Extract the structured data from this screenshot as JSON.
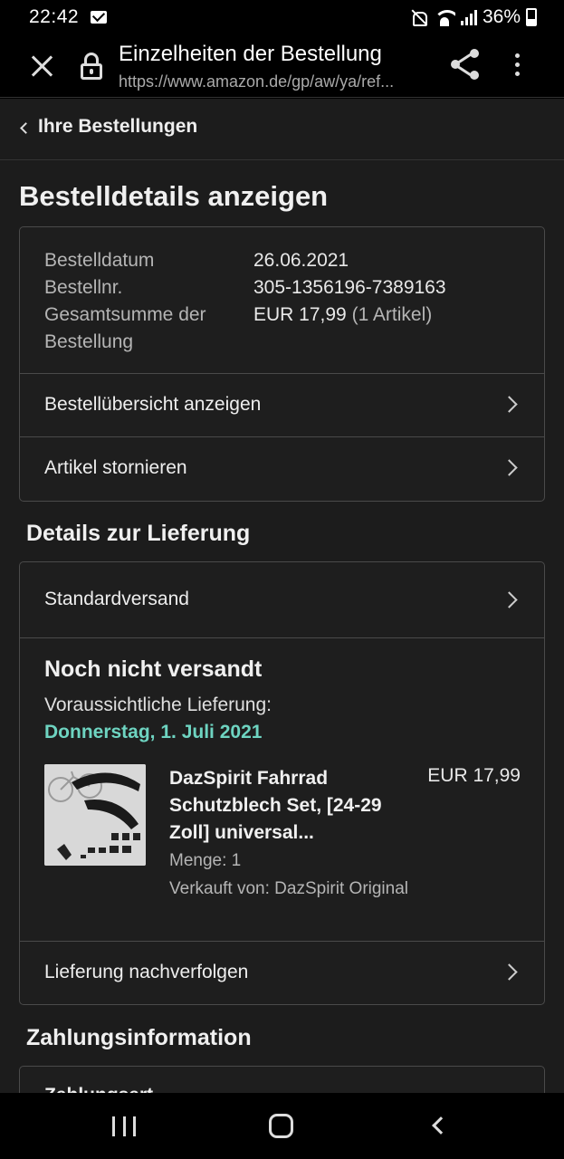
{
  "status_bar": {
    "time": "22:42",
    "battery": "36%",
    "icons": [
      "mail-icon",
      "mute-icon",
      "wifi-icon",
      "signal-icon",
      "battery-icon"
    ]
  },
  "browser": {
    "title": "Einzelheiten der Bestellung",
    "url": "https://www.amazon.de/gp/aw/ya/ref...",
    "icons": [
      "close-icon",
      "lock-icon",
      "share-icon",
      "more-icon"
    ]
  },
  "breadcrumb": {
    "label": "Ihre Bestellungen"
  },
  "page_title": "Bestelldetails anzeigen",
  "order": {
    "date_label": "Bestelldatum",
    "date_value": "26.06.2021",
    "number_label": "Bestellnr.",
    "number_value": "305-1356196-7389163",
    "total_label": "Gesamtsumme der Bestellung",
    "total_value": "EUR 17,99",
    "total_items": "(1 Artikel)",
    "link_summary": "Bestellübersicht anzeigen",
    "link_cancel": "Artikel stornieren"
  },
  "delivery": {
    "section_title": "Details zur Lieferung",
    "shipping_method": "Standardversand",
    "status": "Noch nicht versandt",
    "eta_label": "Voraussichtliche Lieferung:",
    "eta_date": "Donnerstag, 1. Juli 2021",
    "product": {
      "name": "DazSpirit Fahrrad Schutzblech Set, [24-29 Zoll] universal...",
      "price": "EUR 17,99",
      "quantity": "Menge: 1",
      "seller": "Verkauft von: DazSpirit Original"
    },
    "track_link": "Lieferung nachverfolgen"
  },
  "payment": {
    "section_title": "Zahlungsinformation",
    "row_label": "Zahlungsart"
  },
  "colors": {
    "accent_eta": "#6ed4c1",
    "background": "#1c1c1c",
    "border": "#4a4a4a"
  }
}
